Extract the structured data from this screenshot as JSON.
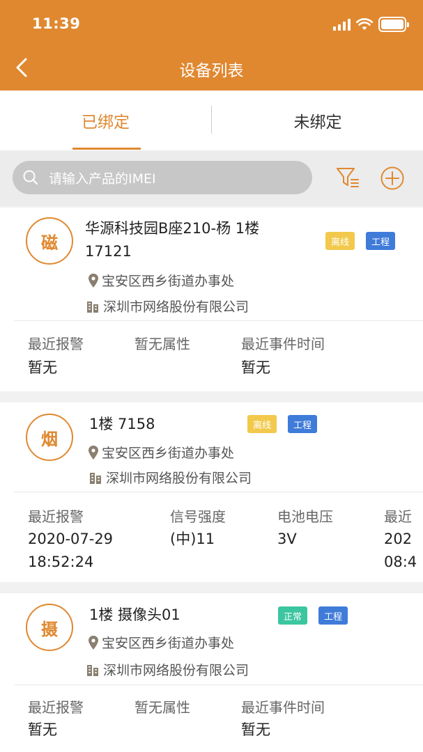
{
  "status_bar": {
    "time": "11:39"
  },
  "nav": {
    "title": "设备列表"
  },
  "tabs": [
    {
      "label": "已绑定",
      "active": true
    },
    {
      "label": "未绑定",
      "active": false
    }
  ],
  "search": {
    "placeholder": "请输入产品的IMEI"
  },
  "colors": {
    "accent": "#e08830",
    "offline": "#f2c94c",
    "project": "#3f7bd9",
    "normal": "#3cc6a0"
  },
  "devices": [
    {
      "avatar": "磁",
      "name": "华源科技园B座210-杨 1楼 17121",
      "badges": [
        "离线",
        "工程"
      ],
      "location": "宝安区西乡街道办事处",
      "org": "深圳市网络股份有限公司",
      "stats": [
        {
          "label": "最近报警",
          "value": "暂无"
        },
        {
          "label": "暂无属性",
          "value": ""
        },
        {
          "label": "最近事件时间",
          "value": "暂无"
        }
      ]
    },
    {
      "avatar": "烟",
      "name": "1楼 7158",
      "badges": [
        "离线",
        "工程"
      ],
      "location": "宝安区西乡街道办事处",
      "org": "深圳市网络股份有限公司",
      "stats": [
        {
          "label": "最近报警",
          "value": "2020-07-29 18:52:24"
        },
        {
          "label": "信号强度",
          "value": "(中)11"
        },
        {
          "label": "电池电压",
          "value": "3V"
        },
        {
          "label": "最近",
          "value": "202 08:4"
        }
      ]
    },
    {
      "avatar": "摄",
      "name": "1楼 摄像头01",
      "badges": [
        "正常",
        "工程"
      ],
      "location": "宝安区西乡街道办事处",
      "org": "深圳市网络股份有限公司",
      "stats": [
        {
          "label": "最近报警",
          "value": "暂无"
        },
        {
          "label": "暂无属性",
          "value": ""
        },
        {
          "label": "最近事件时间",
          "value": "暂无"
        }
      ]
    }
  ]
}
